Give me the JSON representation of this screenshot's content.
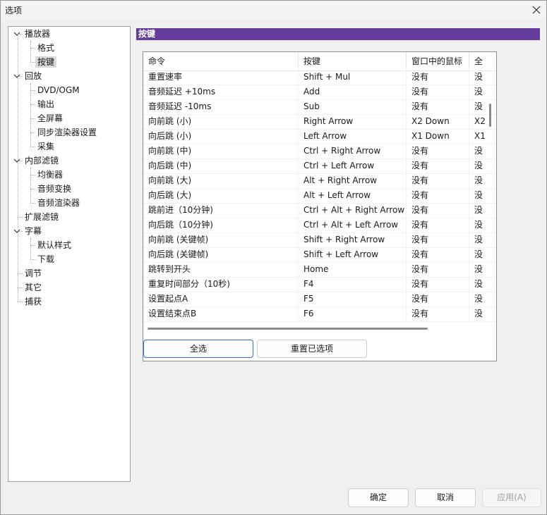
{
  "window": {
    "title": "选项"
  },
  "tree": {
    "items": [
      {
        "label": "播放器",
        "level": 0,
        "expanded": true
      },
      {
        "label": "格式",
        "level": 1
      },
      {
        "label": "按键",
        "level": 1,
        "selected": true
      },
      {
        "label": "回放",
        "level": 0,
        "expanded": true
      },
      {
        "label": "DVD/OGM",
        "level": 1
      },
      {
        "label": "输出",
        "level": 1
      },
      {
        "label": "全屏幕",
        "level": 1
      },
      {
        "label": "同步渲染器设置",
        "level": 1
      },
      {
        "label": "采集",
        "level": 1
      },
      {
        "label": "内部滤镜",
        "level": 0,
        "expanded": true
      },
      {
        "label": "均衡器",
        "level": 1
      },
      {
        "label": "音频变换",
        "level": 1
      },
      {
        "label": "音频渲染器",
        "level": 1
      },
      {
        "label": "扩展滤镜",
        "level": 0
      },
      {
        "label": "字幕",
        "level": 0,
        "expanded": true
      },
      {
        "label": "默认样式",
        "level": 1
      },
      {
        "label": "下载",
        "level": 1
      },
      {
        "label": "调节",
        "level": 0
      },
      {
        "label": "其它",
        "level": 0
      },
      {
        "label": "捕获",
        "level": 0
      }
    ]
  },
  "panel": {
    "header": "按键"
  },
  "table": {
    "columns": [
      "命令",
      "按键",
      "窗口中的鼠标",
      "全"
    ],
    "rows": [
      [
        "重置速率",
        "Shift + Mul",
        "没有",
        "没"
      ],
      [
        "音频延迟 +10ms",
        "Add",
        "没有",
        "没"
      ],
      [
        "音频延迟 -10ms",
        "Sub",
        "没有",
        "没"
      ],
      [
        "向前跳 (小)",
        "Right Arrow",
        "X2 Down",
        "X2"
      ],
      [
        "向后跳 (小)",
        "Left Arrow",
        "X1 Down",
        "X1"
      ],
      [
        "向前跳 (中)",
        "Ctrl + Right Arrow",
        "没有",
        "没"
      ],
      [
        "向后跳 (中)",
        "Ctrl + Left Arrow",
        "没有",
        "没"
      ],
      [
        "向前跳 (大)",
        "Alt + Right Arrow",
        "没有",
        "没"
      ],
      [
        "向后跳 (大)",
        "Alt + Left Arrow",
        "没有",
        "没"
      ],
      [
        "跳前进（10分钟)",
        "Ctrl + Alt + Right Arrow",
        "没有",
        "没"
      ],
      [
        "向后跳（10分钟)",
        "Ctrl + Alt + Left Arrow",
        "没有",
        "没"
      ],
      [
        "向前跳 (关键帧)",
        "Shift + Right Arrow",
        "没有",
        "没"
      ],
      [
        "向后跳 (关键帧)",
        "Shift + Left Arrow",
        "没有",
        "没"
      ],
      [
        "跳转到开头",
        "Home",
        "没有",
        "没"
      ],
      [
        "重复时间部分（10秒)",
        "F4",
        "没有",
        "没"
      ],
      [
        "设置起点A",
        "F5",
        "没有",
        "没"
      ],
      [
        "设置结束点B",
        "F6",
        "没有",
        "没"
      ]
    ]
  },
  "buttons": {
    "select_all": "全选",
    "reset_selected": "重置已选项",
    "ok": "确定",
    "cancel": "取消",
    "apply": "应用(A)"
  },
  "colors": {
    "header_bg": "#643c9c",
    "accent_border": "#2e6ac2"
  },
  "icons": {
    "close": "close-icon",
    "expander": "collapse-minus-icon"
  }
}
